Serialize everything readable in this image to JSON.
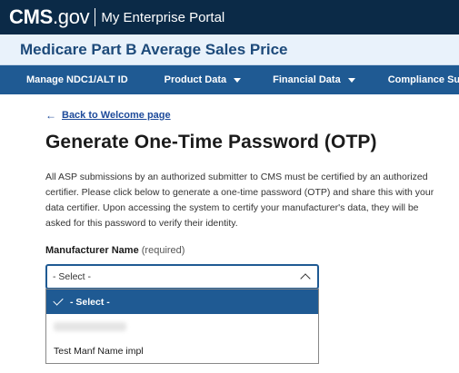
{
  "header": {
    "logo_text": "CMS",
    "logo_suffix": ".gov",
    "portal_name": "My Enterprise Portal"
  },
  "app": {
    "title": "Medicare Part B Average Sales Price"
  },
  "nav": {
    "items": [
      {
        "label": "Manage NDC1/ALT ID",
        "has_dropdown": false
      },
      {
        "label": "Product Data",
        "has_dropdown": true
      },
      {
        "label": "Financial Data",
        "has_dropdown": true
      },
      {
        "label": "Compliance Summary",
        "has_dropdown": false
      }
    ]
  },
  "page": {
    "back_link": "Back to Welcome page",
    "title": "Generate One-Time Password (OTP)",
    "description": "All ASP submissions by an authorized submitter to CMS must be certified by an authorized certifier. Please click below to generate a one-time password (OTP) and share this with your data certifier. Upon accessing the system to certify your manufacturer's data, they will be asked for this password to verify their identity."
  },
  "form": {
    "manufacturer": {
      "label": "Manufacturer Name",
      "required_text": " (required)",
      "selected_value": "- Select -",
      "options": [
        {
          "label": "- Select -",
          "selected": true,
          "redacted": false
        },
        {
          "label": "",
          "selected": false,
          "redacted": true
        },
        {
          "label": "Test Manf Name impl",
          "selected": false,
          "redacted": false
        }
      ]
    }
  },
  "colors": {
    "top_bar": "#0b2a47",
    "app_bar": "#e9f2fb",
    "nav_bar": "#1f5a93",
    "link": "#1d4a9a",
    "selected_option": "#1f5a93"
  }
}
